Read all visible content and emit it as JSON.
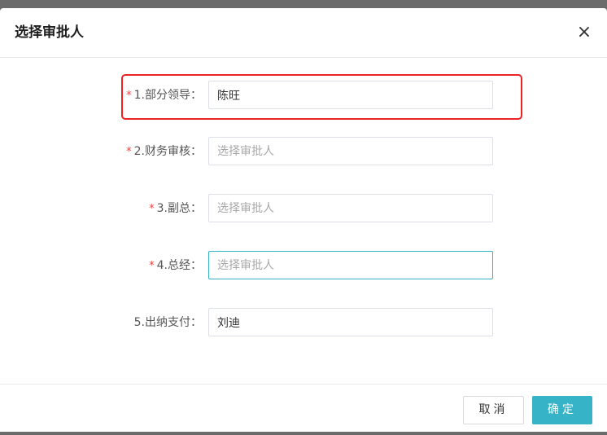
{
  "dialog": {
    "title": "选择审批人",
    "close_icon": "×"
  },
  "form": {
    "fields": [
      {
        "label": "1.部分领导：",
        "required": true,
        "value": "陈旺",
        "placeholder": "选择审批人"
      },
      {
        "label": "2.财务审核：",
        "required": true,
        "value": "",
        "placeholder": "选择审批人"
      },
      {
        "label": "3.副总：",
        "required": true,
        "value": "",
        "placeholder": "选择审批人"
      },
      {
        "label": "4.总经：",
        "required": true,
        "value": "",
        "placeholder": "选择审批人"
      },
      {
        "label": "5.出纳支付：",
        "required": false,
        "value": "刘迪",
        "placeholder": "选择审批人"
      }
    ],
    "required_mark": "*"
  },
  "footer": {
    "cancel_label": "取消",
    "ok_label": "确定"
  },
  "colors": {
    "primary": "#36b3c6",
    "required": "#f04545",
    "highlight": "#ee2222"
  }
}
